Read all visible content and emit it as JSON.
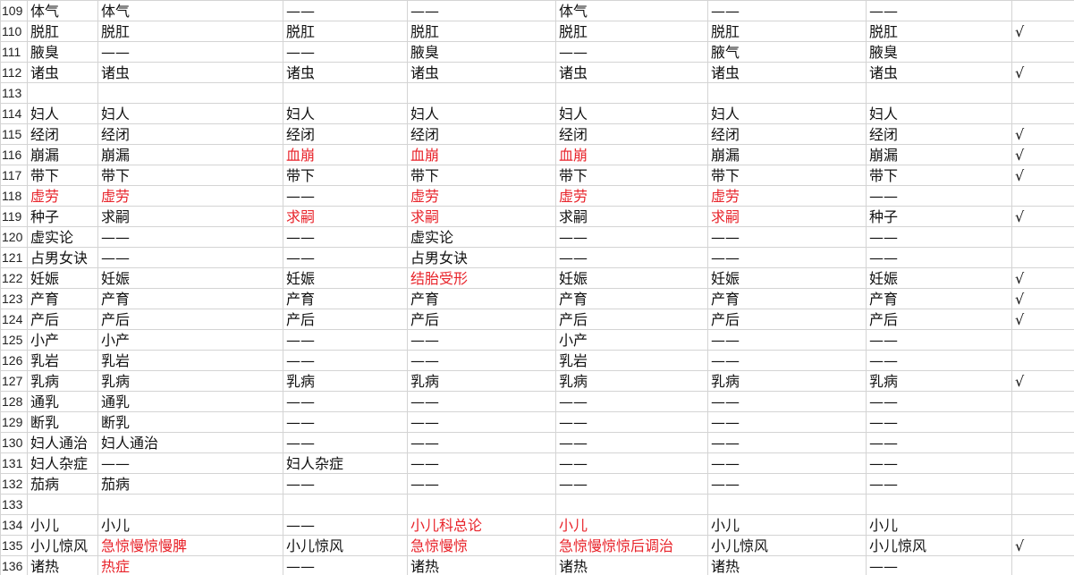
{
  "rows": [
    {
      "n": "109",
      "cells": [
        "体气",
        "体气",
        "——",
        "——",
        "体气",
        "——",
        "——",
        ""
      ]
    },
    {
      "n": "110",
      "cells": [
        "脱肛",
        "脱肛",
        "脱肛",
        "脱肛",
        "脱肛",
        "脱肛",
        "脱肛",
        "√"
      ]
    },
    {
      "n": "111",
      "cells": [
        "腋臭",
        "——",
        "——",
        "腋臭",
        "——",
        "腋气",
        "腋臭",
        ""
      ]
    },
    {
      "n": "112",
      "cells": [
        "诸虫",
        "诸虫",
        "诸虫",
        "诸虫",
        "诸虫",
        "诸虫",
        "诸虫",
        "√"
      ]
    },
    {
      "n": "113",
      "cells": [
        "",
        "",
        "",
        "",
        "",
        "",
        "",
        ""
      ]
    },
    {
      "n": "114",
      "cells": [
        "妇人",
        "妇人",
        "妇人",
        "妇人",
        "妇人",
        "妇人",
        "妇人",
        ""
      ]
    },
    {
      "n": "115",
      "cells": [
        "经闭",
        "经闭",
        "经闭",
        "经闭",
        "经闭",
        "经闭",
        "经闭",
        "√"
      ]
    },
    {
      "n": "116",
      "cells": [
        "崩漏",
        "崩漏",
        "血崩",
        "血崩",
        "血崩",
        "崩漏",
        "崩漏",
        "√"
      ],
      "red": [
        2,
        3,
        4
      ]
    },
    {
      "n": "117",
      "cells": [
        "带下",
        "带下",
        "带下",
        "带下",
        "带下",
        "带下",
        "带下",
        "√"
      ]
    },
    {
      "n": "118",
      "cells": [
        "虚劳",
        "虚劳",
        "——",
        "虚劳",
        "虚劳",
        "虚劳",
        "——",
        ""
      ],
      "red": [
        0,
        1,
        3,
        4,
        5
      ]
    },
    {
      "n": "119",
      "cells": [
        "种子",
        "求嗣",
        "求嗣",
        "求嗣",
        "求嗣",
        "求嗣",
        "种子",
        "√"
      ],
      "red": [
        2,
        3,
        5
      ]
    },
    {
      "n": "120",
      "cells": [
        "虚实论",
        "——",
        "——",
        "虚实论",
        "——",
        "——",
        "——",
        ""
      ]
    },
    {
      "n": "121",
      "cells": [
        "占男女诀",
        "——",
        "——",
        "占男女诀",
        "——",
        "——",
        "——",
        ""
      ]
    },
    {
      "n": "122",
      "cells": [
        "妊娠",
        "妊娠",
        "妊娠",
        "结胎受形",
        "妊娠",
        "妊娠",
        "妊娠",
        "√"
      ],
      "red": [
        3
      ]
    },
    {
      "n": "123",
      "cells": [
        "产育",
        "产育",
        "产育",
        "产育",
        "产育",
        "产育",
        "产育",
        "√"
      ]
    },
    {
      "n": "124",
      "cells": [
        "产后",
        "产后",
        "产后",
        "产后",
        "产后",
        "产后",
        "产后",
        "√"
      ]
    },
    {
      "n": "125",
      "cells": [
        "小产",
        "小产",
        "——",
        "——",
        "小产",
        "——",
        "——",
        ""
      ]
    },
    {
      "n": "126",
      "cells": [
        "乳岩",
        "乳岩",
        "——",
        "——",
        "乳岩",
        "——",
        "——",
        ""
      ]
    },
    {
      "n": "127",
      "cells": [
        "乳病",
        "乳病",
        "乳病",
        "乳病",
        "乳病",
        "乳病",
        "乳病",
        "√"
      ]
    },
    {
      "n": "128",
      "cells": [
        "通乳",
        "通乳",
        "——",
        "——",
        "——",
        "——",
        "——",
        ""
      ]
    },
    {
      "n": "129",
      "cells": [
        "断乳",
        "断乳",
        "——",
        "——",
        "——",
        "——",
        "——",
        ""
      ]
    },
    {
      "n": "130",
      "cells": [
        "妇人通治",
        "妇人通治",
        "——",
        "——",
        "——",
        "——",
        "——",
        ""
      ]
    },
    {
      "n": "131",
      "cells": [
        "妇人杂症",
        "——",
        "妇人杂症",
        "——",
        "——",
        "——",
        "——",
        ""
      ]
    },
    {
      "n": "132",
      "cells": [
        "茄病",
        "茄病",
        "——",
        "——",
        "——",
        "——",
        "——",
        ""
      ]
    },
    {
      "n": "133",
      "cells": [
        "",
        "",
        "",
        "",
        "",
        "",
        "",
        ""
      ]
    },
    {
      "n": "134",
      "cells": [
        "小儿",
        "小儿",
        "——",
        "小儿科总论",
        "小儿",
        "小儿",
        "小儿",
        ""
      ],
      "red": [
        3,
        4
      ]
    },
    {
      "n": "135",
      "cells": [
        "小儿惊风",
        "急惊慢惊慢脾",
        "小儿惊风",
        "急惊慢惊",
        "急惊慢惊惊后调治",
        "小儿惊风",
        "小儿惊风",
        "√"
      ],
      "red": [
        1,
        3,
        4
      ]
    },
    {
      "n": "136",
      "cells": [
        "诸热",
        "热症",
        "——",
        "诸热",
        "诸热",
        "诸热",
        "——",
        ""
      ],
      "red": [
        1
      ]
    }
  ]
}
